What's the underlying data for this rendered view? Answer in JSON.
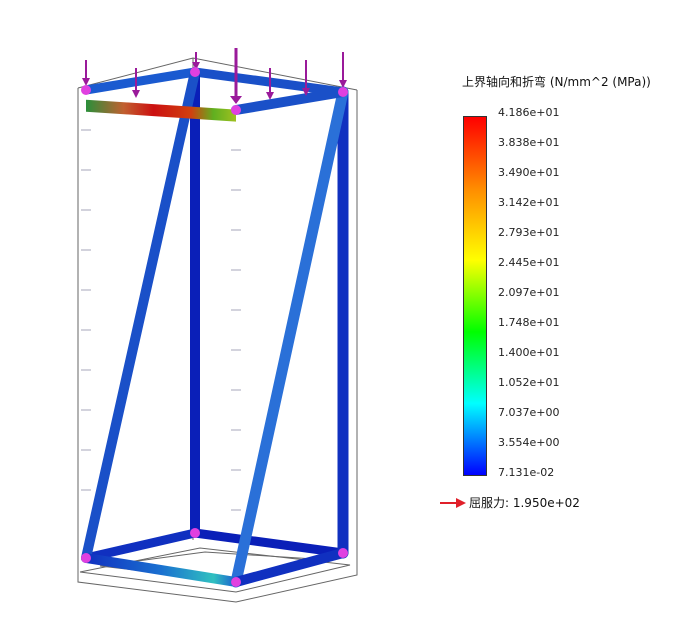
{
  "legend": {
    "title": "上界轴向和折弯 (N/mm^2 (MPa))",
    "colors": [
      "#ff0000",
      "#ff8c00",
      "#ffff00",
      "#00ff00",
      "#00ffff",
      "#0000ff"
    ],
    "ticks": [
      "4.186e+01",
      "3.838e+01",
      "3.490e+01",
      "3.142e+01",
      "2.793e+01",
      "2.445e+01",
      "2.097e+01",
      "1.748e+01",
      "1.400e+01",
      "1.052e+01",
      "7.037e+00",
      "3.554e+00",
      "7.131e-02"
    ],
    "yield_label": "屈服力: 1.950e+02",
    "yield_arrow_color": "#e0202a"
  },
  "model": {
    "load_arrow_color": "#9a1a9a",
    "node_color": "#e040e0"
  }
}
